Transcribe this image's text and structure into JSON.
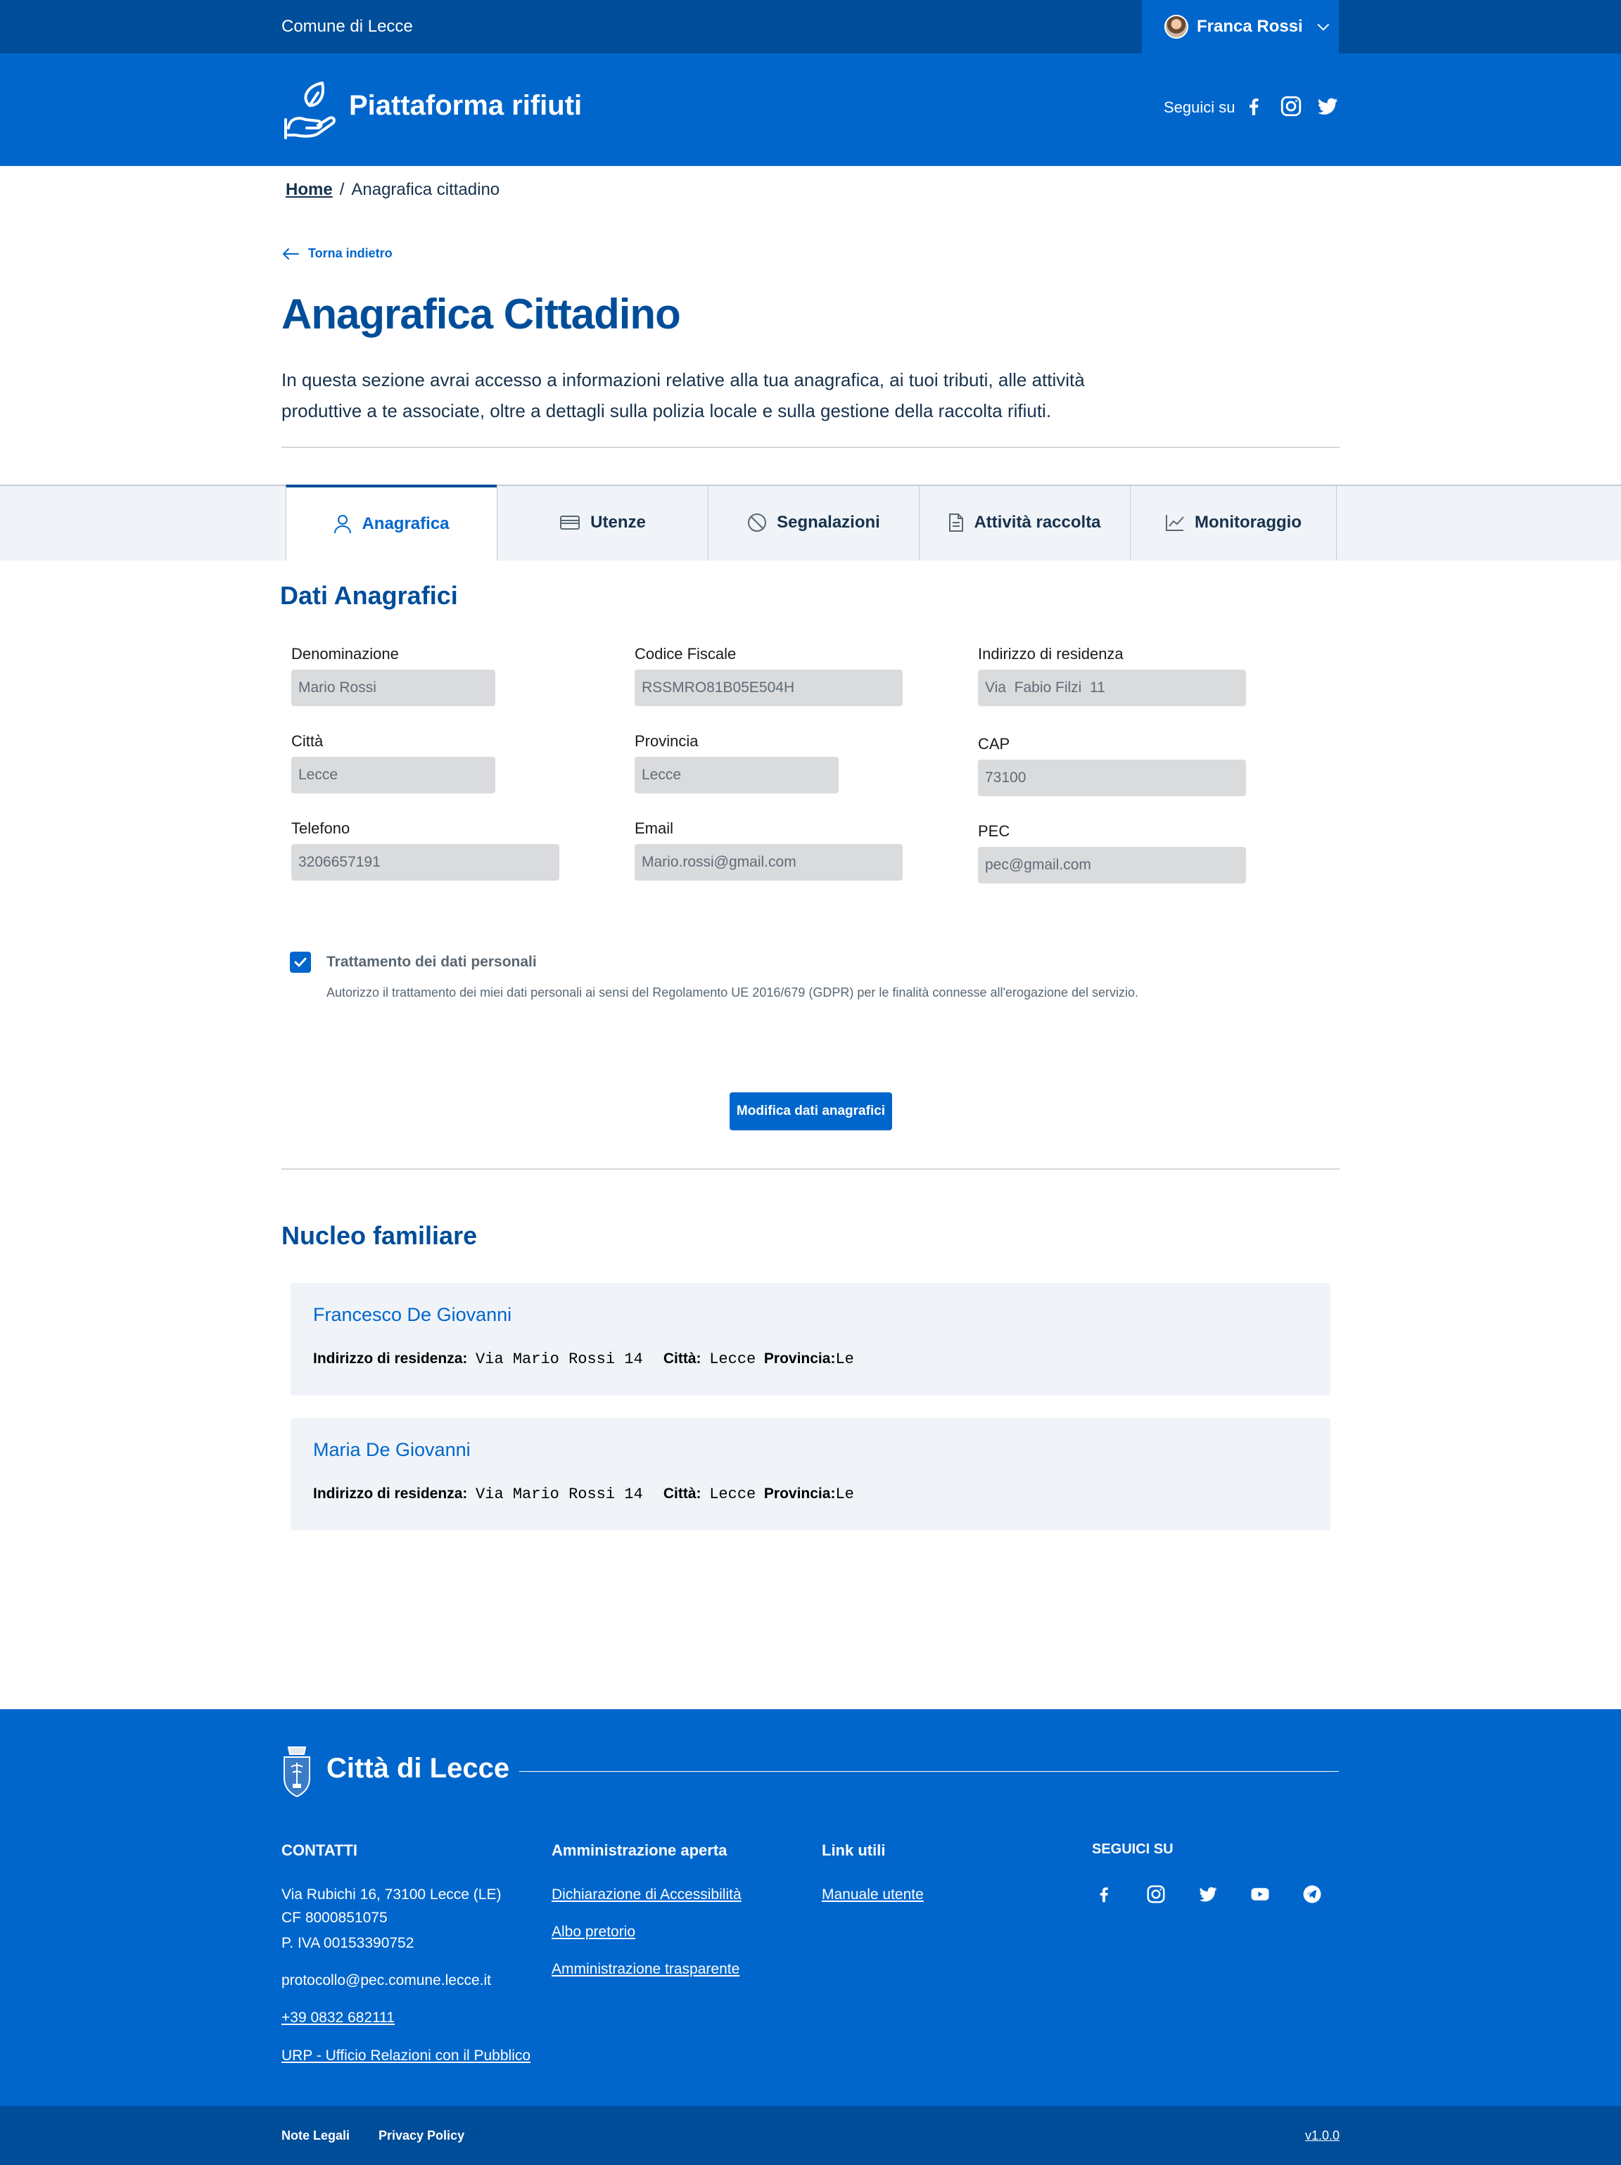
{
  "slim_header": {
    "org_name": "Comune di Lecce",
    "user_name": "Franca Rossi"
  },
  "header": {
    "brand": "Piattaforma rifiuti",
    "follow_label": "Seguici su",
    "social": [
      "facebook-icon",
      "instagram-icon",
      "twitter-icon"
    ]
  },
  "breadcrumb": {
    "home": "Home",
    "separator": "/",
    "current": "Anagrafica cittadino"
  },
  "back_label": "Torna indietro",
  "page": {
    "title": "Anagrafica Cittadino",
    "lead": "In questa sezione avrai accesso a informazioni relative alla tua anagrafica, ai tuoi tributi, alle attività produttive a te associate, oltre a dettagli sulla polizia locale e sulla gestione della raccolta rifiuti."
  },
  "tabs": [
    {
      "label": "Anagrafica",
      "icon": "user-icon",
      "active": true
    },
    {
      "label": "Utenze",
      "icon": "credit-card-icon",
      "active": false
    },
    {
      "label": "Segnalazioni",
      "icon": "ban-icon",
      "active": false
    },
    {
      "label": "Attività raccolta",
      "icon": "document-icon",
      "active": false
    },
    {
      "label": "Monitoraggio",
      "icon": "chart-icon",
      "active": false
    }
  ],
  "dati": {
    "title": "Dati Anagrafici",
    "fields": {
      "denominazione": {
        "label": "Denominazione",
        "value": "Mario Rossi"
      },
      "codice_fiscale": {
        "label": "Codice Fiscale",
        "value": "RSSMRO81B05E504H"
      },
      "indirizzo": {
        "label": "Indirizzo di residenza",
        "value": "Via  Fabio Filzi  11"
      },
      "citta": {
        "label": "Città",
        "value": "Lecce"
      },
      "provincia": {
        "label": "Provincia",
        "value": "Lecce"
      },
      "cap": {
        "label": "CAP",
        "value": "73100"
      },
      "telefono": {
        "label": "Telefono",
        "value": "3206657191"
      },
      "email": {
        "label": "Email",
        "value": "Mario.rossi@gmail.com"
      },
      "pec": {
        "label": "PEC",
        "value": "pec@gmail.com"
      }
    },
    "consent": {
      "title": "Trattamento dei dati personali",
      "description": "Autorizzo il trattamento dei miei dati personali ai sensi del Regolamento UE 2016/679 (GDPR) per le finalità connesse all'erogazione del servizio.",
      "checked": true
    },
    "edit_button": "Modifica dati anagrafici"
  },
  "nucleo": {
    "title": "Nucleo familiare",
    "labels": {
      "address": "Indirizzo di residenza:",
      "city": "Città:",
      "province": "Provincia:"
    },
    "members": [
      {
        "name": "Francesco De Giovanni",
        "address": "Via Mario Rossi 14",
        "city": "Lecce",
        "province": "Le"
      },
      {
        "name": "Maria De Giovanni",
        "address": "Via Mario Rossi 14",
        "city": "Lecce",
        "province": "Le"
      }
    ]
  },
  "footer": {
    "title": "Città di Lecce",
    "contatti": {
      "heading": "CONTATTI",
      "address": "Via Rubichi 16, 73100 Lecce (LE)",
      "cf": "CF 8000851075",
      "piva": "P. IVA 00153390752",
      "pec": "protocollo@pec.comune.lecce.it",
      "phone": "+39 0832 682111",
      "urp": "URP - Ufficio Relazioni con il Pubblico"
    },
    "amministrazione": {
      "heading": "Amministrazione aperta",
      "links": [
        "Dichiarazione di Accessibilità",
        "Albo pretorio",
        "Amministrazione trasparente"
      ]
    },
    "link_utili": {
      "heading": "Link utili",
      "links": [
        "Manuale utente"
      ]
    },
    "seguici": {
      "heading": "SEGUICI SU",
      "icons": [
        "facebook-icon",
        "instagram-icon",
        "twitter-icon",
        "youtube-icon",
        "telegram-icon"
      ]
    },
    "bottom": {
      "note_legali": "Note Legali",
      "privacy": "Privacy Policy",
      "version": "v1.0.0"
    }
  },
  "colors": {
    "primary": "#0066cc",
    "primary_dark": "#004d99",
    "text": "#17324d",
    "input_bg": "#dadbdd",
    "card_bg": "#f0f4f8"
  }
}
